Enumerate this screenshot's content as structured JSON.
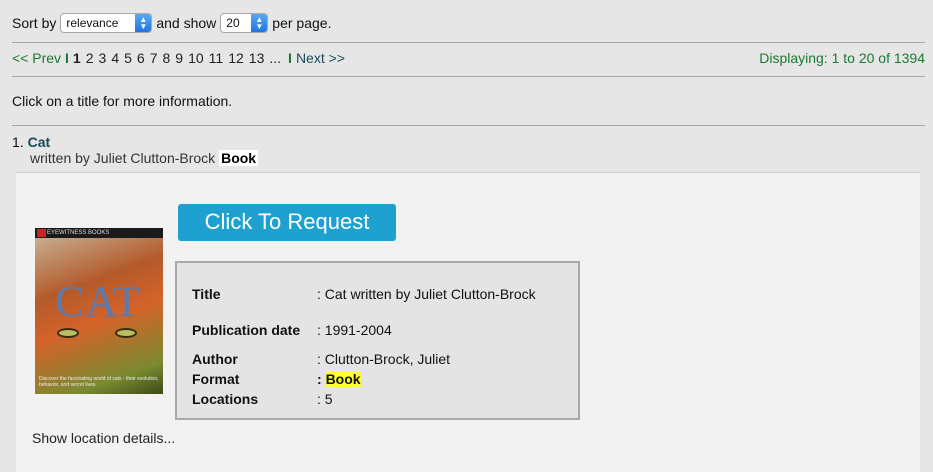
{
  "sort": {
    "prefix": "Sort by",
    "sort_value": "relevance",
    "middle": "and show",
    "per_page_value": "20",
    "suffix": "per page."
  },
  "pager": {
    "prev": "<< Prev",
    "separator": "I",
    "pages": [
      "1",
      "2",
      "3",
      "4",
      "5",
      "6",
      "7",
      "8",
      "9",
      "10",
      "11",
      "12",
      "13",
      "..."
    ],
    "current_page": "1",
    "next": "Next >>",
    "displaying": "Displaying: 1 to 20 of 1394"
  },
  "instructions": "Click on a title for more information.",
  "result": {
    "number": "1.",
    "title": "Cat",
    "byline": "written by Juliet Clutton-Brock",
    "format_badge": "Book",
    "cover": {
      "series_label": "EYEWITNESS BOOKS",
      "cover_title": "CAT",
      "blurb": "Discover the fascinating world of cats - their evolution, behavior, and secret lives"
    },
    "request_button": "Click To Request",
    "details": [
      {
        "key": "Title",
        "value": ": Cat written by Juliet Clutton-Brock"
      },
      {
        "key": "Publication date",
        "value": ": 1991-2004"
      },
      {
        "key": "Author",
        "value": ": Clutton-Brock, Juliet"
      },
      {
        "key": "Format",
        "value_prefix": ": ",
        "value": "Book"
      },
      {
        "key": "Locations",
        "value": ": 5"
      }
    ],
    "show_location": "Show location details..."
  },
  "colors": {
    "background": "#e6e6e6",
    "link_green": "#1a7a30",
    "button_blue": "#1ea0d0",
    "highlight_yellow": "#ffff33"
  }
}
